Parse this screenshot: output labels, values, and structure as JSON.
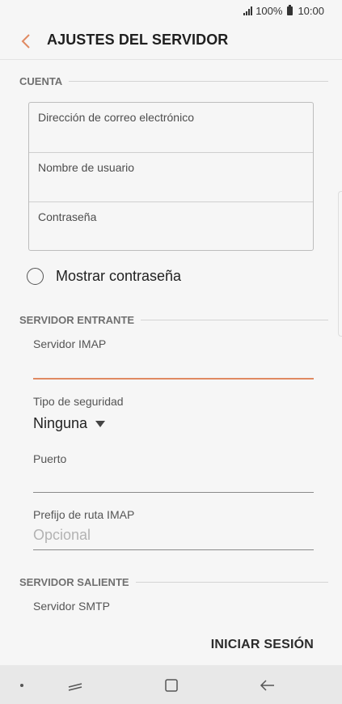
{
  "status_bar": {
    "battery": "100%",
    "time": "10:00"
  },
  "header": {
    "title": "AJUSTES DEL SERVIDOR"
  },
  "account": {
    "section_title": "CUENTA",
    "fields": [
      {
        "label": "Dirección de correo electrónico",
        "value": ""
      },
      {
        "label": "Nombre de usuario",
        "value": ""
      },
      {
        "label": "Contraseña",
        "value": ""
      }
    ],
    "show_password_label": "Mostrar contraseña"
  },
  "incoming": {
    "section_title": "SERVIDOR ENTRANTE",
    "imap_server_label": "Servidor IMAP",
    "imap_server_value": "",
    "security_label": "Tipo de seguridad",
    "security_value": "Ninguna",
    "port_label": "Puerto",
    "port_value": "",
    "prefix_label": "Prefijo de ruta IMAP",
    "prefix_placeholder": "Opcional"
  },
  "outgoing": {
    "section_title": "SERVIDOR SALIENTE",
    "smtp_server_label": "Servidor SMTP"
  },
  "actions": {
    "signin_label": "INICIAR SESIÓN"
  },
  "colors": {
    "accent": "#e08a62",
    "background": "#f6f6f6"
  }
}
